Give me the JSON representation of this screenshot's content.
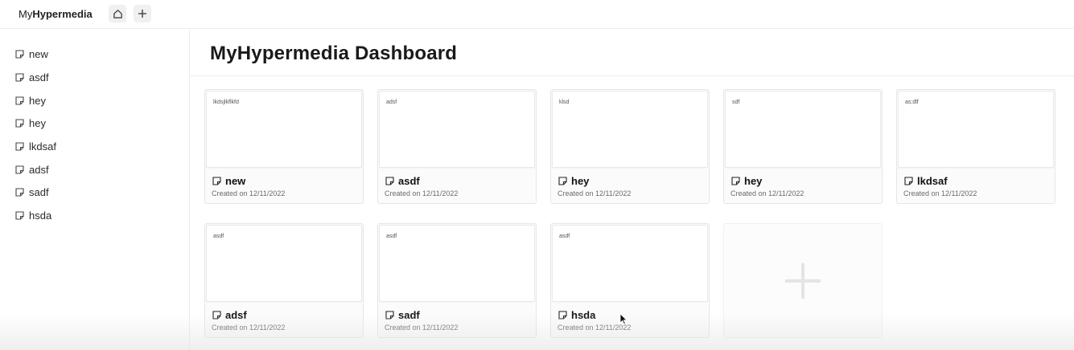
{
  "topbar": {
    "brand_prefix": "My",
    "brand_bold": "Hypermedia",
    "home_icon": "home-icon",
    "add_icon": "plus-icon"
  },
  "sidebar": {
    "items": [
      {
        "label": "new",
        "icon": "note-icon"
      },
      {
        "label": "asdf",
        "icon": "note-icon"
      },
      {
        "label": "hey",
        "icon": "note-icon"
      },
      {
        "label": "hey",
        "icon": "note-icon"
      },
      {
        "label": "lkdsaf",
        "icon": "note-icon"
      },
      {
        "label": "adsf",
        "icon": "note-icon"
      },
      {
        "label": "sadf",
        "icon": "note-icon"
      },
      {
        "label": "hsda",
        "icon": "note-icon"
      }
    ]
  },
  "main": {
    "title": "MyHypermedia Dashboard",
    "cards": [
      {
        "preview": "lkdsjlkflkfd",
        "title": "new",
        "date": "Created on 12/11/2022"
      },
      {
        "preview": "adsf",
        "title": "asdf",
        "date": "Created on 12/11/2022"
      },
      {
        "preview": "klsd",
        "title": "hey",
        "date": "Created on 12/11/2022"
      },
      {
        "preview": "sdf",
        "title": "hey",
        "date": "Created on 12/11/2022"
      },
      {
        "preview": "as;dlf",
        "title": "lkdsaf",
        "date": "Created on 12/11/2022"
      },
      {
        "preview": "asdf",
        "title": "adsf",
        "date": "Created on 12/11/2022"
      },
      {
        "preview": "asdf",
        "title": "sadf",
        "date": "Created on 12/11/2022"
      },
      {
        "preview": "asdf",
        "title": "hsda",
        "date": "Created on 12/11/2022"
      }
    ],
    "add_card_icon": "plus-icon"
  },
  "colors": {
    "border": "#ececec",
    "text": "#1c1c1c",
    "muted": "#6b6b6b",
    "button_bg": "#f0f0f0"
  }
}
